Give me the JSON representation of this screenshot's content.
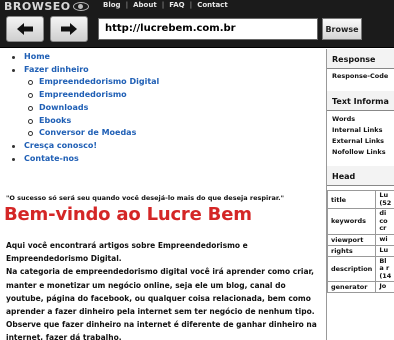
{
  "topbar": {
    "logo_text": "BROWSEO",
    "nav": [
      "Blog",
      "About",
      "FAQ",
      "Contact"
    ],
    "url": "http://lucrebem.com.br",
    "browse_label": "Browse"
  },
  "menu": {
    "items": [
      {
        "label": "Home"
      },
      {
        "label": "Fazer dinheiro",
        "children": [
          {
            "label": "Empreendedorismo Digital"
          },
          {
            "label": "Empreendedorismo"
          },
          {
            "label": "Downloads"
          },
          {
            "label": "Ebooks"
          },
          {
            "label": "Conversor de Moedas"
          }
        ]
      },
      {
        "label": "Cresça conosco!"
      },
      {
        "label": "Contate-nos"
      }
    ]
  },
  "main": {
    "quote": "\"O sucesso só será seu quando você desejá-lo mais do que deseja respirar.\"",
    "headline": "Bem-vindo ao Lucre Bem",
    "paragraph1": "Aqui você encontrará artigos sobre Empreendedorismo e Empreendedorismo Digital.",
    "paragraph2": "Na categoria de empreendedorismo digital você irá aprender como criar, manter e monetizar um negócio online, seja ele um blog, canal do youtube, página do facebook, ou qualquer coisa relacionada, bem como aprender a fazer dinheiro pela internet sem ter negócio de nenhum tipo. Observe que fazer dinheiro na internet é diferente de ganhar dinheiro na internet, fazer dá trabalho."
  },
  "panel": {
    "response_title": "Response",
    "response_code_label": "Response-Code",
    "text_info_title": "Text Informa",
    "text_rows": [
      "Words",
      "Internal Links",
      "External Links",
      "Nofollow Links"
    ],
    "head_title": "Head",
    "head_rows": [
      {
        "key": "title",
        "value": "Lu\n(52"
      },
      {
        "key": "keywords",
        "value": "di\nco\ncr"
      },
      {
        "key": "viewport",
        "value": "wi"
      },
      {
        "key": "rights",
        "value": "Lu"
      },
      {
        "key": "description",
        "value": "Bl\na r\n(14"
      },
      {
        "key": "generator",
        "value": "Jo"
      }
    ]
  },
  "colors": {
    "topbar_bg": "#1b1b1b",
    "link": "#1f5fb5",
    "headline": "#d42626"
  }
}
